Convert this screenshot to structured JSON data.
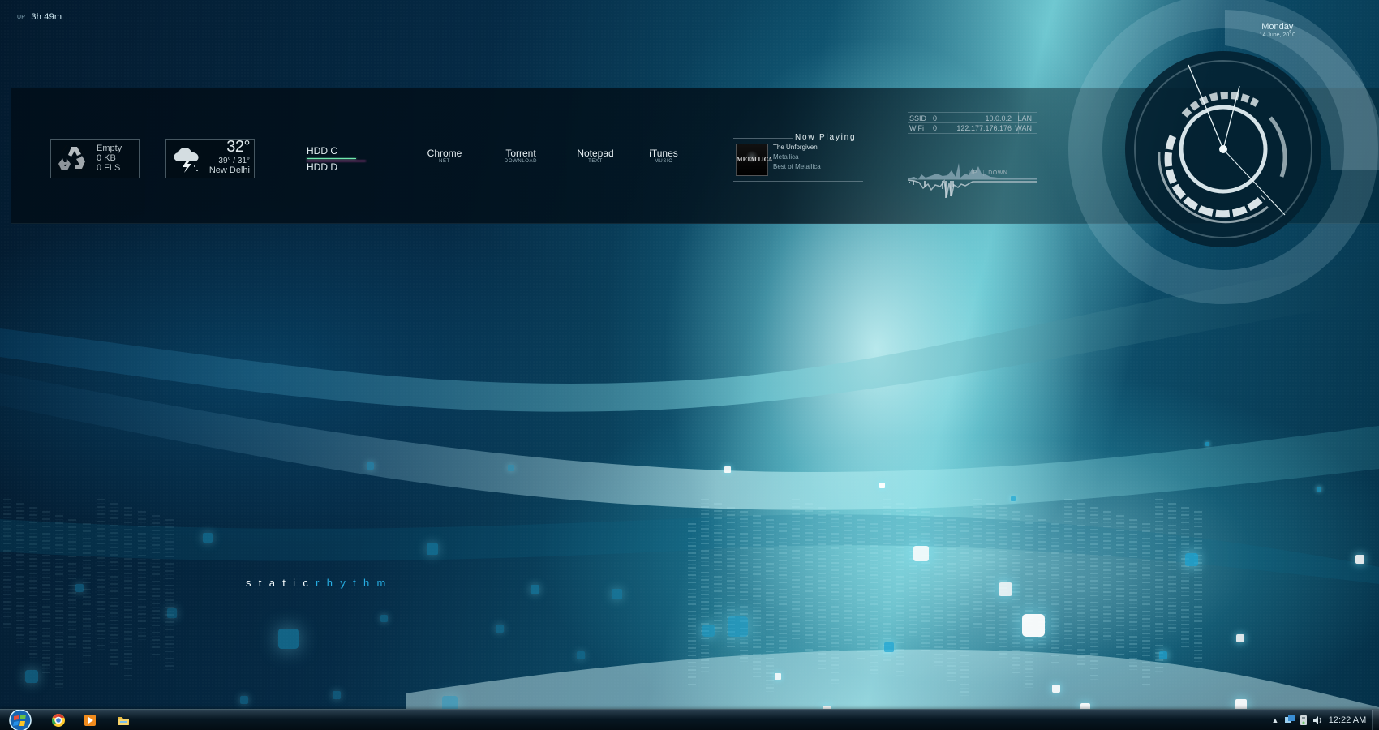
{
  "desktop": {
    "wallpaper_text": {
      "white": "static",
      "blue": "rhythm"
    },
    "accent_colors": {
      "teal": "#27aee3",
      "highlight": "#b8f8fa",
      "hdd_c": "#70e9ae",
      "hdd_d": "#db51b3"
    }
  },
  "status": {
    "uptime_label": "UP",
    "uptime_value": "3h 49m"
  },
  "date": {
    "day": "Monday",
    "full": "14 June, 2010"
  },
  "widgets": {
    "recycle_bin": {
      "icon": "recycle-bin-icon",
      "status": "Empty",
      "size": "0 KB",
      "files": "0 FLS"
    },
    "weather": {
      "icon": "thunderstorm-cloud-icon",
      "temperature": "32°",
      "range": "39° / 31°",
      "city": "New Delhi"
    },
    "drives": [
      {
        "label": "HDD C",
        "usage_fraction": 0.84,
        "color": "#70e9ae"
      },
      {
        "label": "HDD D",
        "usage_fraction": 1.0,
        "color": "#db51b3"
      }
    ],
    "launchers": [
      {
        "title": "Chrome",
        "subtitle": "NET"
      },
      {
        "title": "Torrent",
        "subtitle": "DOWNLOAD"
      },
      {
        "title": "Notepad",
        "subtitle": "TEXT"
      },
      {
        "title": "iTunes",
        "subtitle": "MUSIC"
      }
    ],
    "now_playing": {
      "heading": "Now Playing",
      "album_art_text": "METALLICA",
      "track": "The Unforgiven",
      "artist": "Metallica",
      "album": "Best of Metallica"
    },
    "network": {
      "rows": [
        {
          "name": "SSID",
          "count": "0",
          "ip": "10.0.0.2",
          "port": "LAN"
        },
        {
          "name": "WiFi",
          "count": "0",
          "ip": "122.177.176.176",
          "port": "WAN"
        }
      ],
      "legend": {
        "up": "UP",
        "down": "DOWN"
      }
    }
  },
  "taskbar": {
    "clock": "12:22 AM",
    "tray_arrow": "▲",
    "icons": {
      "start": "windows-start-icon",
      "chrome": "chrome-icon",
      "media": "media-player-icon",
      "folder": "folder-icon",
      "network": "network-icon",
      "disk": "removable-disk-icon",
      "volume": "volume-icon"
    }
  }
}
